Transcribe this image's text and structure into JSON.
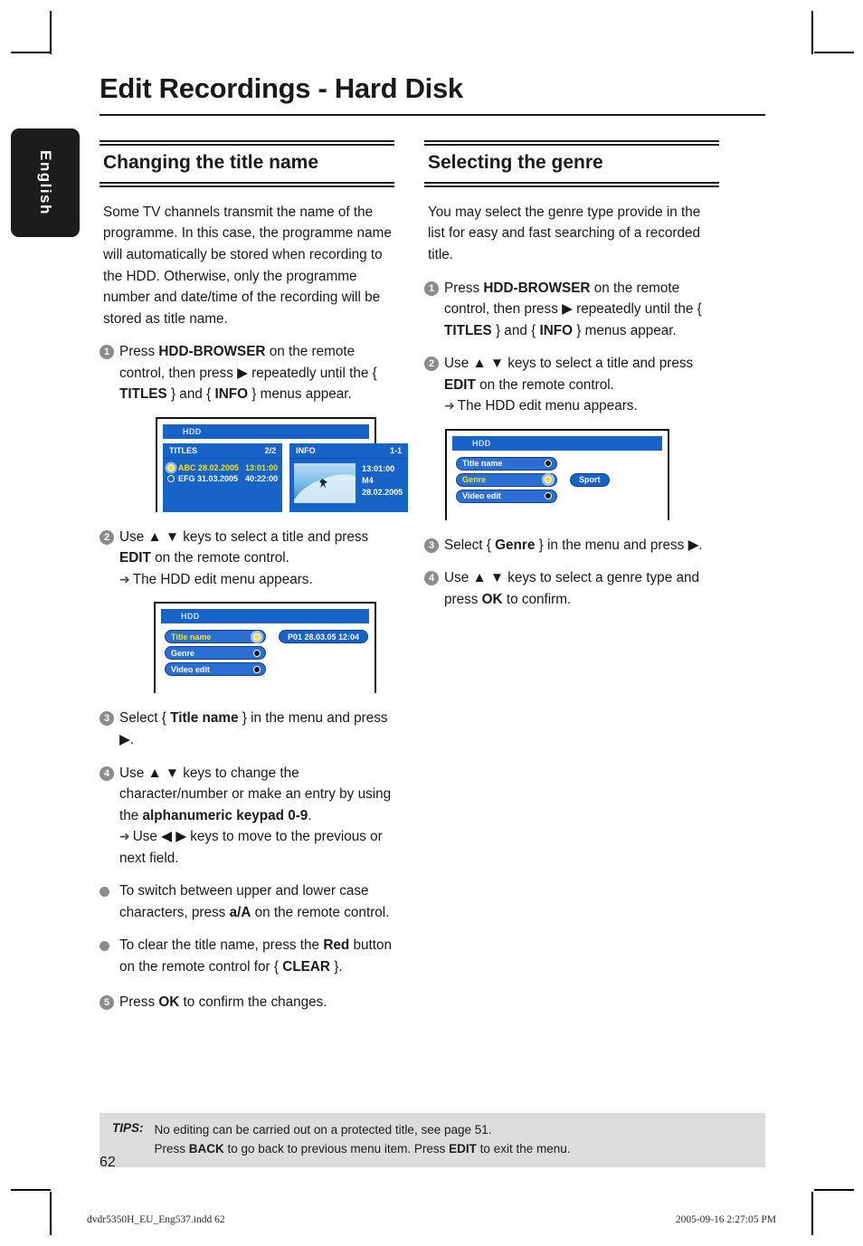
{
  "page": {
    "title": "Edit Recordings - Hard Disk",
    "number": "62",
    "language_tab": "English"
  },
  "left_column": {
    "heading": "Changing the title name",
    "intro": "Some TV channels transmit the name of the programme. In this case, the programme name will automatically be stored when recording to the HDD. Otherwise, only the programme number and date/time of the recording will be stored as title name.",
    "steps": [
      {
        "num": "1",
        "text_parts": [
          {
            "t": "Press ",
            "b": false
          },
          {
            "t": "HDD-BROWSER",
            "b": true
          },
          {
            "t": " on the remote control, then press ",
            "b": false
          },
          {
            "t": "▶",
            "b": false
          },
          {
            "t": " repeatedly until the { ",
            "b": false
          },
          {
            "t": "TITLES",
            "b": true
          },
          {
            "t": " } and { ",
            "b": false
          },
          {
            "t": "INFO",
            "b": true
          },
          {
            "t": " } menus appear.",
            "b": false
          }
        ]
      },
      {
        "num": "2",
        "text_parts": [
          {
            "t": "Use ▲ ▼ keys to select a title and press ",
            "b": false
          },
          {
            "t": "EDIT",
            "b": true
          },
          {
            "t": " on the remote control.",
            "b": false
          }
        ],
        "sub": "The HDD edit menu appears."
      },
      {
        "num": "3",
        "text_parts": [
          {
            "t": "Select { ",
            "b": false
          },
          {
            "t": "Title name",
            "b": true
          },
          {
            "t": " } in the menu and press ▶.",
            "b": false
          }
        ]
      },
      {
        "num": "4",
        "text_parts": [
          {
            "t": "Use ▲ ▼ keys to change the character/number or make an entry by using the ",
            "b": false
          },
          {
            "t": "alphanumeric keypad 0-9",
            "b": true
          },
          {
            "t": ".",
            "b": false
          }
        ],
        "sub": "Use ◀ ▶ keys to move to the previous or next field."
      }
    ],
    "bullets": [
      [
        {
          "t": "To switch between upper and lower case characters, press ",
          "b": false
        },
        {
          "t": "a/A",
          "b": true
        },
        {
          "t": " on the remote control.",
          "b": false
        }
      ],
      [
        {
          "t": "To clear the title name, press the ",
          "b": false
        },
        {
          "t": "Red",
          "b": true
        },
        {
          "t": " button on the remote control for { ",
          "b": false
        },
        {
          "t": "CLEAR",
          "b": true
        },
        {
          "t": " }.",
          "b": false
        }
      ]
    ],
    "final_step": {
      "num": "5",
      "text_parts": [
        {
          "t": "Press ",
          "b": false
        },
        {
          "t": "OK",
          "b": true
        },
        {
          "t": " to confirm the changes.",
          "b": false
        }
      ]
    }
  },
  "right_column": {
    "heading": "Selecting the genre",
    "intro": "You may select the genre type provide in the list for easy and fast searching of a recorded title.",
    "steps": [
      {
        "num": "1",
        "text_parts": [
          {
            "t": "Press ",
            "b": false
          },
          {
            "t": "HDD-BROWSER",
            "b": true
          },
          {
            "t": " on the remote control, then press ",
            "b": false
          },
          {
            "t": "▶",
            "b": false
          },
          {
            "t": " repeatedly until the { ",
            "b": false
          },
          {
            "t": "TITLES",
            "b": true
          },
          {
            "t": " } and { ",
            "b": false
          },
          {
            "t": "INFO",
            "b": true
          },
          {
            "t": " } menus appear.",
            "b": false
          }
        ]
      },
      {
        "num": "2",
        "text_parts": [
          {
            "t": "Use ▲ ▼ keys to select a title and press ",
            "b": false
          },
          {
            "t": "EDIT",
            "b": true
          },
          {
            "t": " on the remote control.",
            "b": false
          }
        ],
        "sub": "The HDD edit menu appears."
      },
      {
        "num": "3",
        "text_parts": [
          {
            "t": "Select { ",
            "b": false
          },
          {
            "t": "Genre",
            "b": true
          },
          {
            "t": " } in the menu and press ▶.",
            "b": false
          }
        ]
      },
      {
        "num": "4",
        "text_parts": [
          {
            "t": "Use ▲ ▼ keys to select a genre type and press ",
            "b": false
          },
          {
            "t": "OK",
            "b": true
          },
          {
            "t": " to confirm.",
            "b": false
          }
        ]
      }
    ]
  },
  "screens": {
    "browser": {
      "header": "HDD",
      "titles_pane": {
        "label": "TITLES",
        "counter": "2/2",
        "rows": [
          {
            "name": "ABC 28.02.2005",
            "time": "13:01:00",
            "selected": true
          },
          {
            "name": "EFG 31.03.2005",
            "time": "40:22:00",
            "selected": false
          }
        ]
      },
      "info_pane": {
        "label": "INFO",
        "counter": "1-1",
        "meta": [
          "13:01:00",
          "M4",
          "28.02.2005"
        ]
      }
    },
    "title_name_menu": {
      "header": "HDD",
      "items": [
        {
          "label": "Title name",
          "selected": true
        },
        {
          "label": "Genre",
          "selected": false
        },
        {
          "label": "Video edit",
          "selected": false
        }
      ],
      "value": "P01 28.03.05 12:04",
      "value_row": 0
    },
    "genre_menu": {
      "header": "HDD",
      "items": [
        {
          "label": "Title name",
          "selected": false
        },
        {
          "label": "Genre",
          "selected": true
        },
        {
          "label": "Video edit",
          "selected": false
        }
      ],
      "value": "Sport",
      "value_row": 1
    }
  },
  "tips": {
    "label": "TIPS:",
    "line1": "No editing can be carried out on a protected title, see page 51.",
    "line2_parts": [
      {
        "t": "Press ",
        "b": false
      },
      {
        "t": "BACK",
        "b": true
      },
      {
        "t": " to go back to previous menu item. Press ",
        "b": false
      },
      {
        "t": "EDIT",
        "b": true
      },
      {
        "t": " to exit the menu.",
        "b": false
      }
    ]
  },
  "footer": {
    "left": "dvdr5350H_EU_Eng537.indd   62",
    "right": "2005-09-16   2:27:05 PM"
  },
  "colors": {
    "screen_blue": "#1763c8",
    "pill_blue": "#2b6fd4",
    "highlight_yellow": "#ffe400",
    "tips_bg": "#dcdcdc",
    "step_num_gray": "#8c8c8c"
  }
}
